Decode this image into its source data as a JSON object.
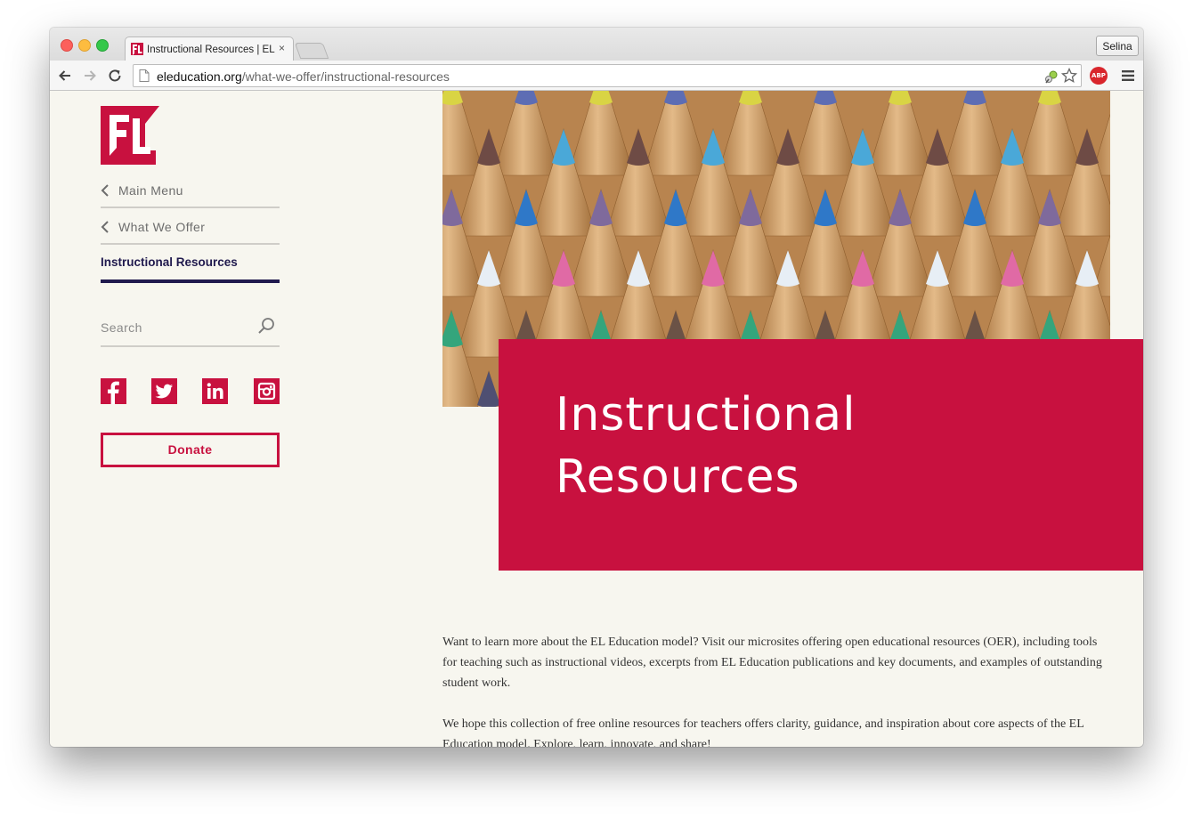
{
  "browser": {
    "tab_title": "Instructional Resources | EL Education",
    "tab_close": "×",
    "profile": "Selina",
    "url_host": "eleducation.org",
    "url_path": "/what-we-offer/instructional-resources",
    "abp": "ABP"
  },
  "sidebar": {
    "nav_back_main": "Main Menu",
    "nav_back_section": "What We Offer",
    "nav_current": "Instructional Resources",
    "search_placeholder": "Search",
    "donate_label": "Donate",
    "social": [
      "facebook-icon",
      "twitter-icon",
      "linkedin-icon",
      "instagram-icon"
    ]
  },
  "hero": {
    "title_line1": "Instructional",
    "title_line2": "Resources"
  },
  "content": {
    "paragraph1": "Want to learn more about the EL Education model? Visit our microsites offering open educational resources (OER), including tools for teaching such as instructional videos, excerpts from EL Education publications and key documents, and examples of outstanding student work.",
    "paragraph2": "We hope this collection of free online resources for teachers offers clarity, guidance, and inspiration about core aspects of the EL Education model. Explore, learn, innovate, and share!"
  },
  "colors": {
    "brand_red": "#c8113f",
    "navy": "#201a4e",
    "page_bg": "#f7f6ef"
  }
}
